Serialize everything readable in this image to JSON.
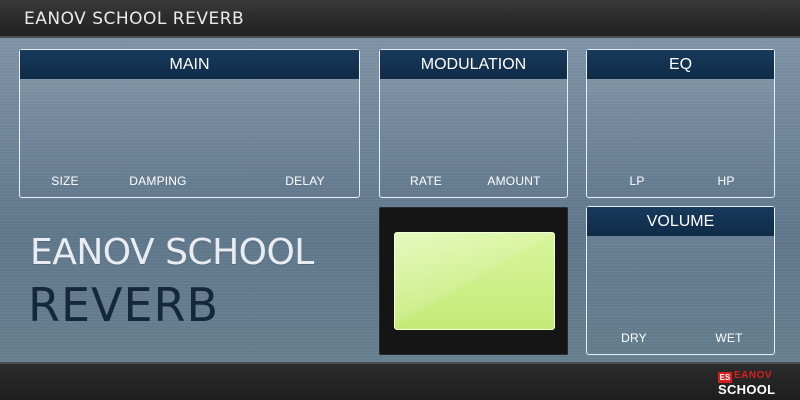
{
  "window": {
    "title": "EANOV SCHOOL REVERB"
  },
  "sections": {
    "main": {
      "title": "MAIN",
      "labels": [
        "SIZE",
        "DAMPING",
        "DELAY"
      ]
    },
    "modulation": {
      "title": "MODULATION",
      "labels": [
        "RATE",
        "AMOUNT"
      ]
    },
    "eq": {
      "title": "EQ",
      "labels": [
        "LP",
        "HP"
      ]
    },
    "volume": {
      "title": "VOLUME",
      "labels": [
        "DRY",
        "WET"
      ]
    }
  },
  "brand": {
    "line1": "EANOV SCHOOL",
    "line2": "REVERB"
  },
  "display": {
    "screen_color": "#cdee88"
  },
  "footer_logo": {
    "badge": "ES",
    "top": "EANOV",
    "bottom": "SCHOOL",
    "accent": "#d62020"
  },
  "colors": {
    "header_bg": "#0f2b47",
    "panel_bg": "#6c8397",
    "brand_dark": "#14273b"
  }
}
